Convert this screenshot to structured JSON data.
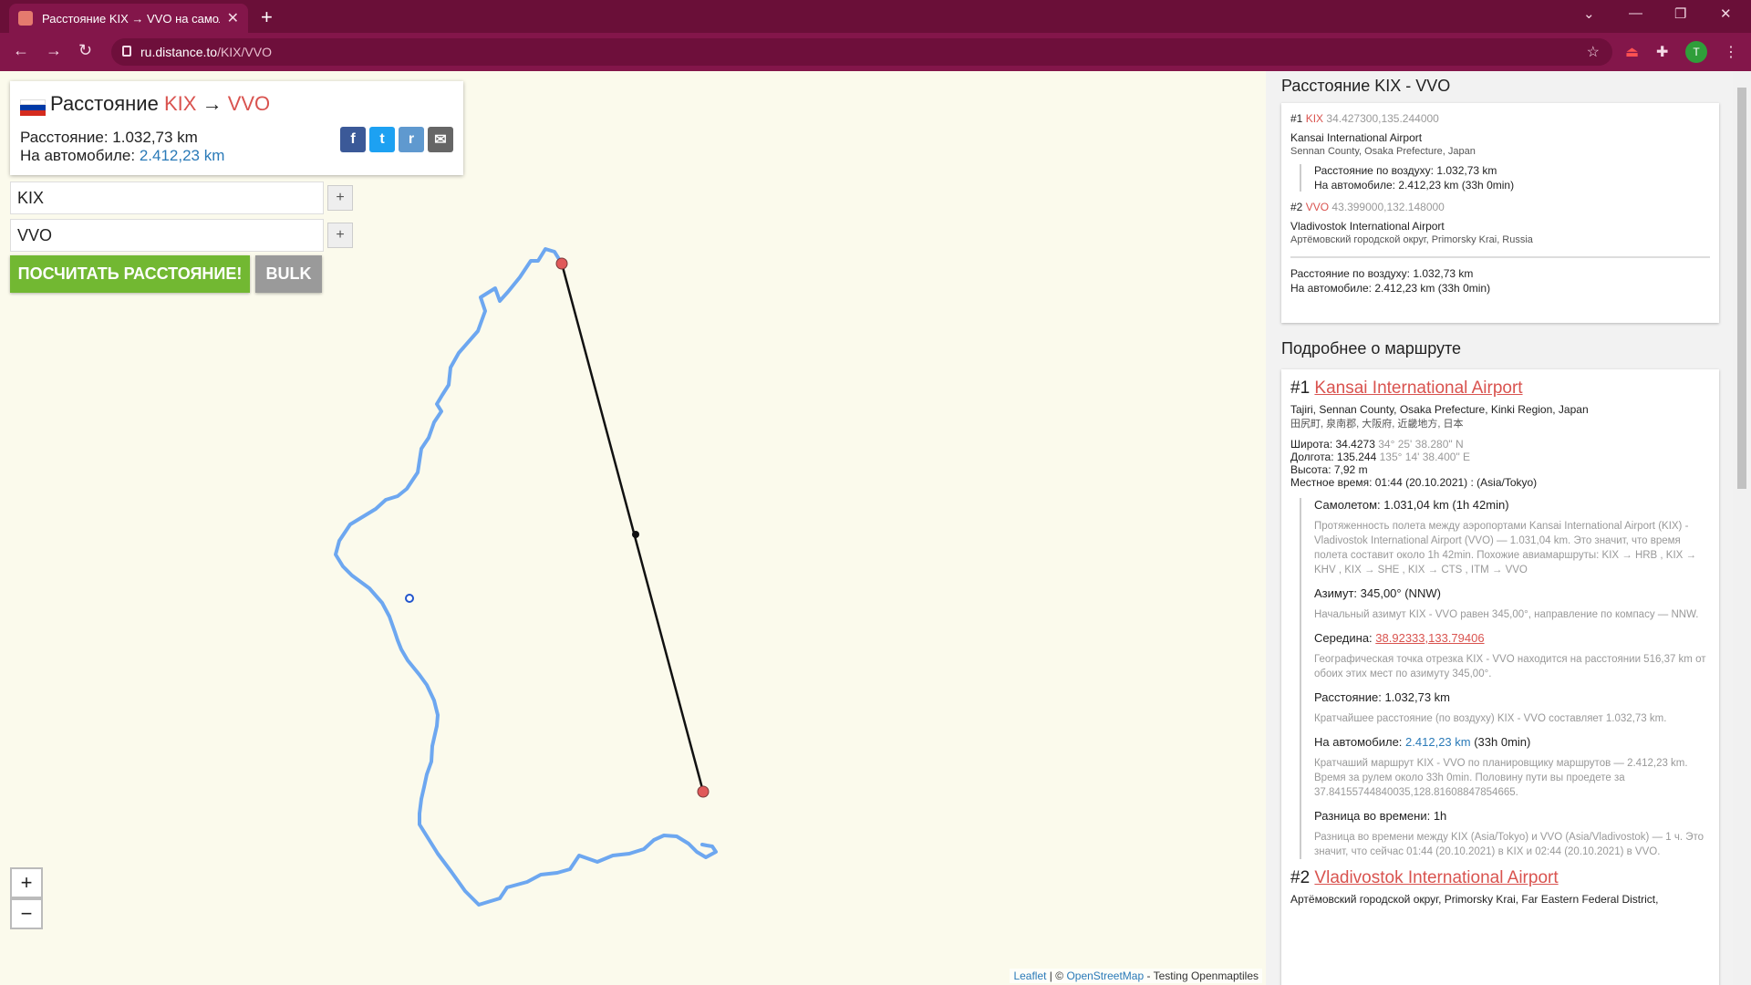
{
  "browser": {
    "tab_title": "Расстояние KIX → VVO на самол",
    "url_domain": "ru.distance.to",
    "url_path": "/KIX/VVO",
    "avatar_letter": "T"
  },
  "card": {
    "title_prefix": "Расстояние",
    "from": "KIX",
    "arrow": "→",
    "to": "VVO",
    "distance_label": "Расстояние:",
    "distance_value": "1.032,73 km",
    "car_label": "На автомобиле:",
    "car_value": "2.412,23 km"
  },
  "form": {
    "from_value": "KIX",
    "to_value": "VVO",
    "plus": "+",
    "calc_button": "ПОСЧИТАТЬ РАССТОЯНИЕ!",
    "bulk_button": "BULK"
  },
  "zoom": {
    "in": "+",
    "out": "−"
  },
  "attribution": {
    "leaflet": "Leaflet",
    "sep": " | © ",
    "osm": "OpenStreetMap",
    "rest": " - Testing Openmaptiles"
  },
  "summary": {
    "heading": "Расстояние KIX - VVO",
    "p1_num": "#1",
    "p1_code": "KIX",
    "p1_coords": "34.427300,135.244000",
    "p1_name": "Kansai International Airport",
    "p1_region": "Sennan County, Osaka Prefecture, Japan",
    "air_label": "Расстояние по воздуху: 1.032,73 km",
    "car_line": "На автомобиле: 2.412,23 km (33h 0min)",
    "p2_num": "#2",
    "p2_code": "VVO",
    "p2_coords": "43.399000,132.148000",
    "p2_name": "Vladivostok International Airport",
    "p2_region": "Артёмовский городской округ, Primorsky Krai, Russia",
    "total_air": "Расстояние по воздуху: 1.032,73 km",
    "total_car": "На автомобиле: 2.412,23 km (33h 0min)"
  },
  "details": {
    "heading": "Подробнее о маршруте",
    "n1": "#1",
    "name1": "Kansai International Airport",
    "addr1": "Tajiri, Sennan County, Osaka Prefecture, Kinki Region, Japan",
    "addr1_local": "田尻町, 泉南郡, 大阪府, 近畿地方, 日本",
    "lat_label": "Широта: 34.4273",
    "lat_dms": "34° 25' 38.280\" N",
    "lon_label": "Долгота: 135.244",
    "lon_dms": "135° 14' 38.400\" E",
    "alt": "Высота: 7,92 m",
    "localtime": "Местное время: 01:44 (20.10.2021) : (Asia/Tokyo)",
    "flight_h": "Самолетом: 1.031,04 km (1h 42min)",
    "flight_txt": "Протяженность полета между аэропортами Kansai International Airport (KIX) - Vladivostok International Airport (VVO) — 1.031,04 km. Это значит, что время полета составит около 1h 42min. Похожие авиамаршруты: KIX → HRB , KIX → KHV , KIX → SHE , KIX → CTS , ITM → VVO",
    "az_h": "Азимут: 345,00° (NNW)",
    "az_txt": "Начальный азимут KIX - VVO равен 345,00°, направление по компасу — NNW.",
    "mid_label": "Середина: ",
    "mid_link": "38.92333,133.79406",
    "mid_txt": "Географическая точка отрезка KIX - VVO находится на расстоянии 516,37 km от обоих этих мест по азимуту 345,00°.",
    "dist_h": "Расстояние: 1.032,73 km",
    "dist_txt": "Кратчайшее расстояние (по воздуху) KIX - VVO составляет 1.032,73 km.",
    "car_h_label": "На автомобиле: ",
    "car_h_val": "2.412,23 km",
    "car_h_rest": " (33h 0min)",
    "car_txt": "Кратчаший маршрут KIX - VVO по планировщику маршрутов — 2.412,23 km. Время за рулем около 33h 0min. Половину пути вы проедете за 37.84155744840035,128.81608847854665.",
    "tz_h": "Разница во времени: 1h",
    "tz_txt": "Разница во времени между KIX (Asia/Tokyo) и VVO (Asia/Vladivostok) — 1 ч. Это значит, что сейчас 01:44 (20.10.2021) в KIX и 02:44 (20.10.2021) в VVO.",
    "n2": "#2",
    "name2": "Vladivostok International Airport",
    "addr2": "Артёмовский городской округ, Primorsky Krai, Far Eastern Federal District,"
  },
  "colors": {
    "chrome": "#6e0f3b",
    "accent_red": "#d9534f",
    "link_blue": "#2a7ab8",
    "route_blue": "#6da7f0",
    "go_green": "#72b832"
  }
}
